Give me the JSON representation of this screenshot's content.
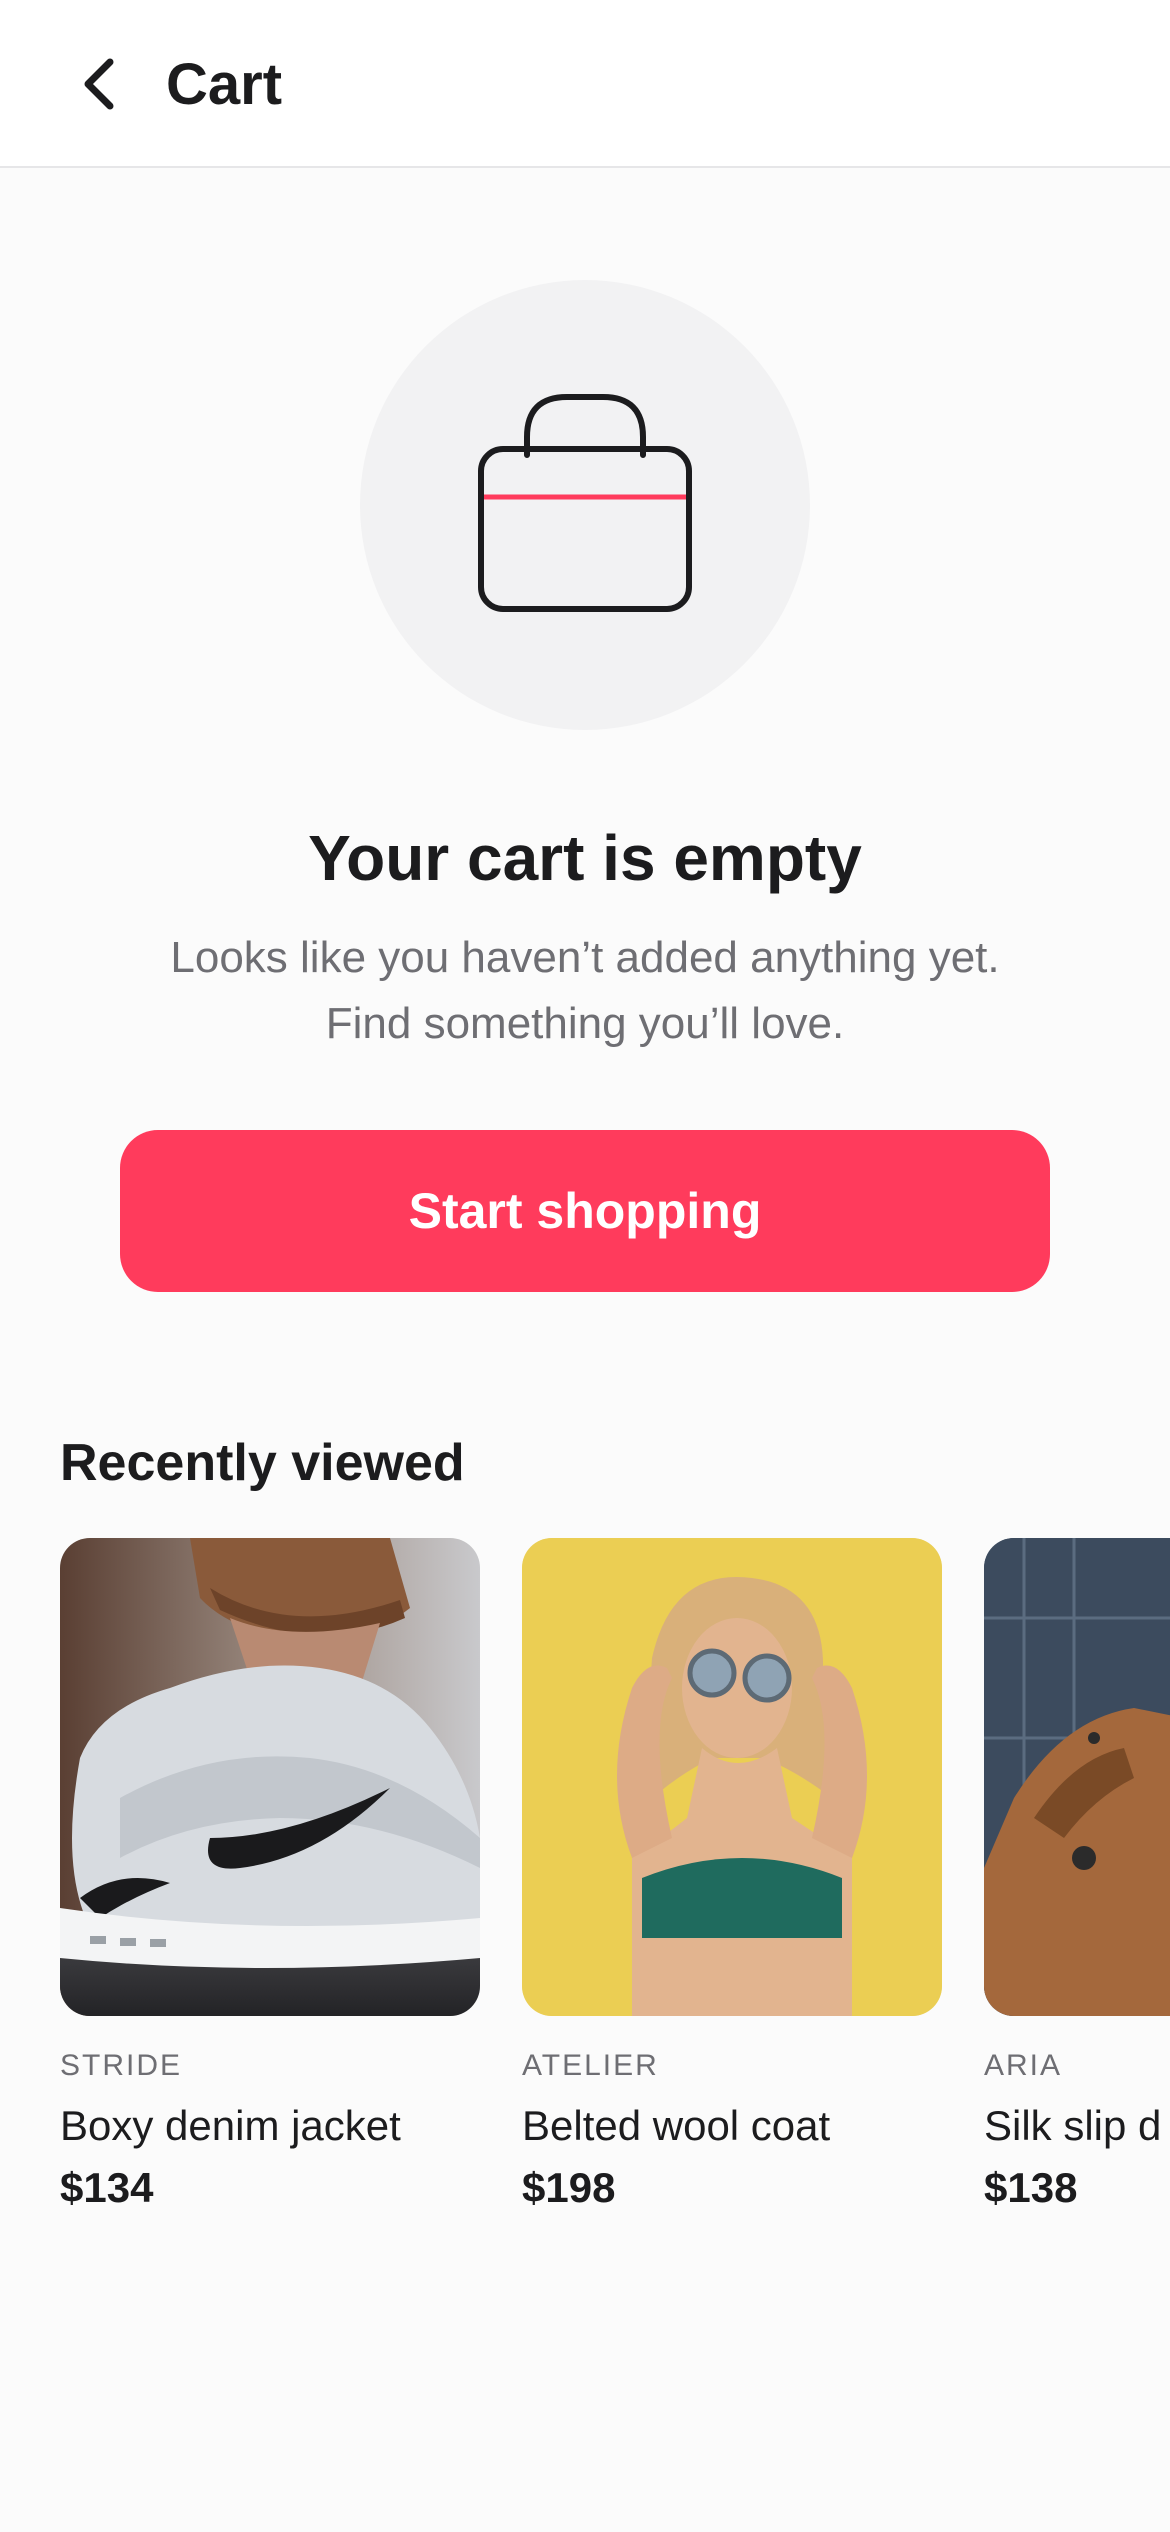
{
  "header": {
    "title": "Cart"
  },
  "empty_state": {
    "title": "Your cart is empty",
    "subtitle": "Looks like you haven’t added anything yet. Find something you’ll love.",
    "cta_label": "Start shopping",
    "icon": "shopping-bag-icon"
  },
  "recently_viewed": {
    "title": "Recently viewed",
    "items": [
      {
        "brand": "STRIDE",
        "name": "Boxy denim jacket",
        "price": "$134",
        "image": "sneaker-photo"
      },
      {
        "brand": "ATELIER",
        "name": "Belted wool coat",
        "price": "$198",
        "image": "woman-sunglasses-photo"
      },
      {
        "brand": "ARIA",
        "name": "Silk slip d",
        "price": "$138",
        "image": "leather-jacket-photo"
      }
    ]
  },
  "colors": {
    "accent": "#ff3b5c",
    "text_primary": "#1c1c1e",
    "text_secondary": "#6e6e73",
    "background": "#fbfbfb"
  }
}
